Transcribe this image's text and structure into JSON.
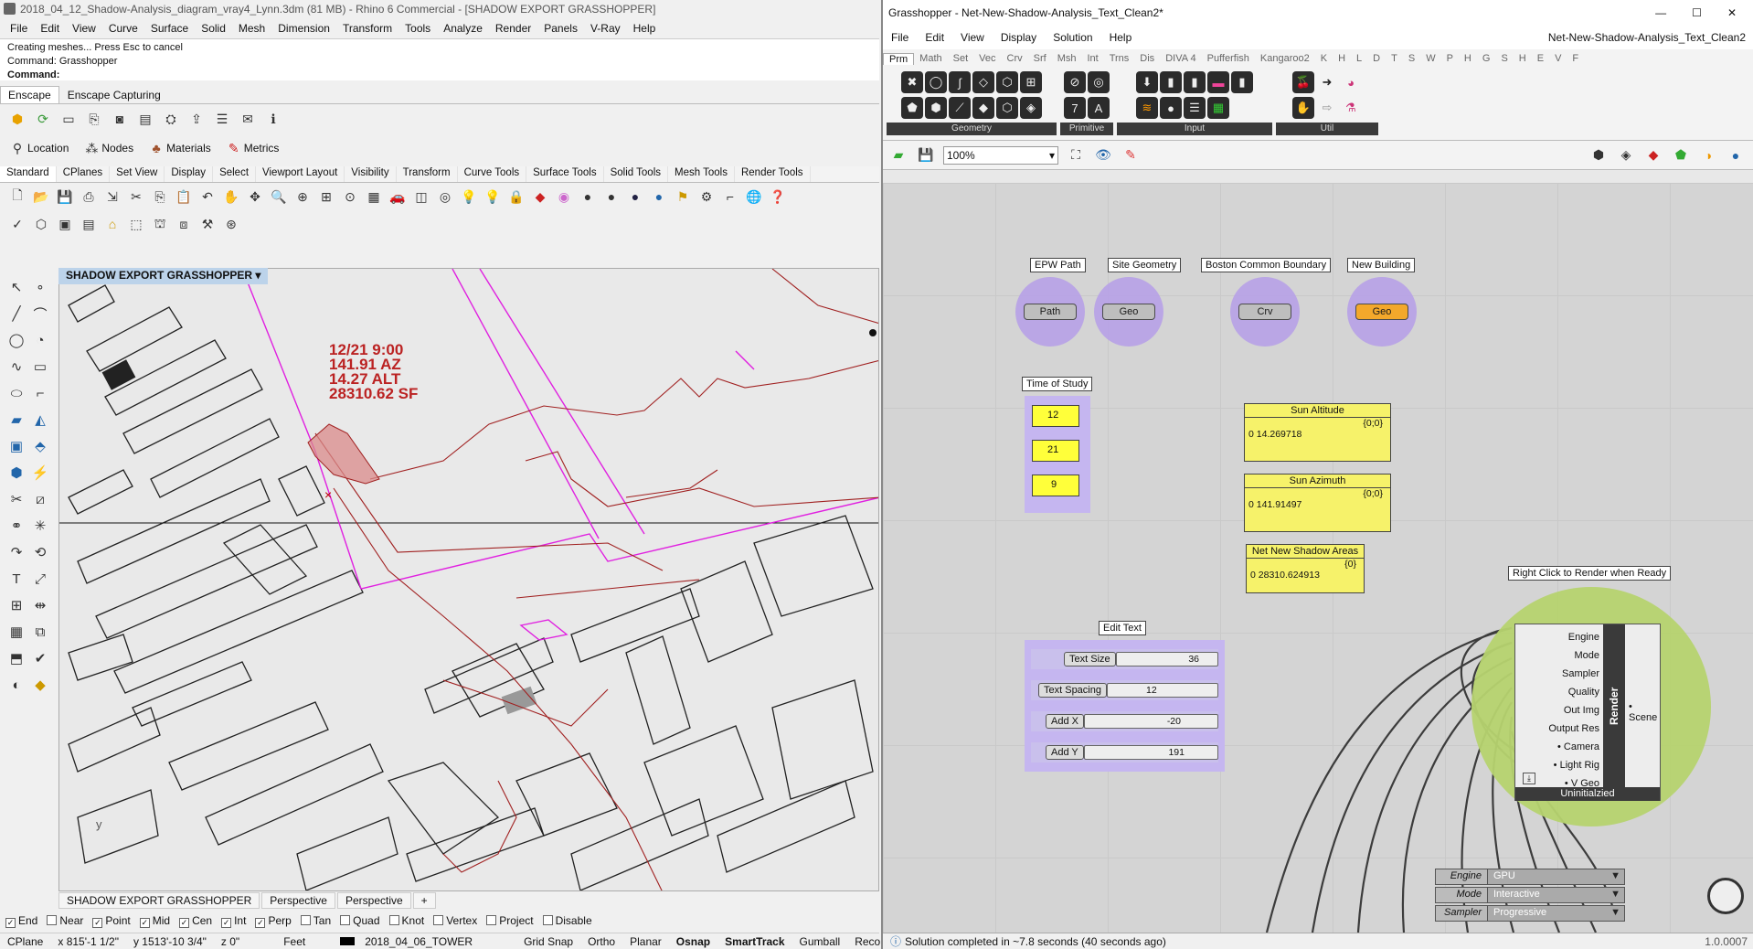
{
  "rhino": {
    "title": "2018_04_12_Shadow-Analysis_diagram_vray4_Lynn.3dm (81 MB) - Rhino 6 Commercial - [SHADOW EXPORT GRASSHOPPER]",
    "menu": [
      "File",
      "Edit",
      "View",
      "Curve",
      "Surface",
      "Solid",
      "Mesh",
      "Dimension",
      "Transform",
      "Tools",
      "Analyze",
      "Render",
      "Panels",
      "V-Ray",
      "Help"
    ],
    "cmd_lines": [
      "Creating meshes... Press Esc to cancel",
      "Command: Grasshopper",
      "Command:"
    ],
    "enscape_tabs": [
      "Enscape",
      "Enscape Capturing"
    ],
    "enscape_tools": [
      "Location",
      "Nodes",
      "Materials",
      "Metrics"
    ],
    "toolbar_tabs": [
      "Standard",
      "CPlanes",
      "Set View",
      "Display",
      "Select",
      "Viewport Layout",
      "Visibility",
      "Transform",
      "Curve Tools",
      "Surface Tools",
      "Solid Tools",
      "Mesh Tools",
      "Render Tools"
    ],
    "viewport_title": "SHADOW EXPORT GRASSHOPPER",
    "annotation": [
      "12/21 9:00",
      "141.91 AZ",
      "14.27 ALT",
      "28310.62 SF"
    ],
    "axis_y": "y",
    "viewport_tabs": [
      "SHADOW EXPORT GRASSHOPPER",
      "Perspective",
      "Perspective",
      "+"
    ],
    "osnaps": [
      {
        "label": "End",
        "on": true
      },
      {
        "label": "Near",
        "on": false
      },
      {
        "label": "Point",
        "on": true
      },
      {
        "label": "Mid",
        "on": true
      },
      {
        "label": "Cen",
        "on": true
      },
      {
        "label": "Int",
        "on": true
      },
      {
        "label": "Perp",
        "on": true
      },
      {
        "label": "Tan",
        "on": false
      },
      {
        "label": "Quad",
        "on": false
      },
      {
        "label": "Knot",
        "on": false
      },
      {
        "label": "Vertex",
        "on": false
      },
      {
        "label": "Project",
        "on": false
      },
      {
        "label": "Disable",
        "on": false
      }
    ],
    "status": {
      "cplane": "CPlane",
      "x": "x 815'-1 1/2\"",
      "y": "y 1513'-10 3/4\"",
      "z": "z 0\"",
      "units": "Feet",
      "layer": "2018_04_06_TOWER",
      "grid": "Grid Snap",
      "ortho": "Ortho",
      "planar": "Planar",
      "osnap": "Osnap",
      "smarttrack": "SmartTrack",
      "gumball": "Gumball",
      "record": "Record H"
    }
  },
  "gh": {
    "title": "Grasshopper - Net-New-Shadow-Analysis_Text_Clean2*",
    "doc_name": "Net-New-Shadow-Analysis_Text_Clean2",
    "menu": [
      "File",
      "Edit",
      "View",
      "Display",
      "Solution",
      "Help"
    ],
    "tabs": [
      "Prm",
      "Math",
      "Set",
      "Vec",
      "Crv",
      "Srf",
      "Msh",
      "Int",
      "Trns",
      "Dis",
      "DIVA 4",
      "Pufferfish",
      "Kangaroo2",
      "K",
      "H",
      "L",
      "D",
      "T",
      "S",
      "W",
      "P",
      "H",
      "G",
      "S",
      "H",
      "E",
      "V",
      "F"
    ],
    "groups": [
      "Geometry",
      "Primitive",
      "Input",
      "Util"
    ],
    "zoom": "100%",
    "params": [
      {
        "caption": "EPW Path",
        "label": "Path"
      },
      {
        "caption": "Site Geometry",
        "label": "Geo"
      },
      {
        "caption": "Boston Common Boundary",
        "label": "Crv"
      },
      {
        "caption": "New Building",
        "label": "Geo"
      }
    ],
    "time_caption": "Time of Study",
    "time_values": [
      "12",
      "21",
      "9"
    ],
    "panels": [
      {
        "title": "Sun Altitude",
        "path": "{0;0}",
        "index": "0",
        "value": "14.269718"
      },
      {
        "title": "Sun Azimuth",
        "path": "{0;0}",
        "index": "0",
        "value": "141.91497"
      },
      {
        "title": "Net New Shadow Areas",
        "path": "{0}",
        "index": "0",
        "value": "28310.624913"
      }
    ],
    "edit_text_caption": "Edit Text",
    "sliders": [
      {
        "label": "Text Size",
        "value": "36"
      },
      {
        "label": "Text Spacing",
        "value": "12"
      },
      {
        "label": "Add X",
        "value": "-20"
      },
      {
        "label": "Add Y",
        "value": "191"
      }
    ],
    "render_caption": "Right Click to Render when Ready",
    "render_inputs": [
      "Engine",
      "Mode",
      "Sampler",
      "Quality",
      "Out Img",
      "Output Res",
      "• Camera",
      "• Light Rig",
      "• V Geo"
    ],
    "render_name": "Render",
    "render_output": "• Scene",
    "render_state": "Uninitialzied",
    "drops": [
      {
        "key": "Engine",
        "value": "GPU"
      },
      {
        "key": "Mode",
        "value": "Interactive"
      },
      {
        "key": "Sampler",
        "value": "Progressive"
      }
    ],
    "status": "Solution completed in ~7.8 seconds (40 seconds ago)",
    "version": "1.0.0007"
  }
}
